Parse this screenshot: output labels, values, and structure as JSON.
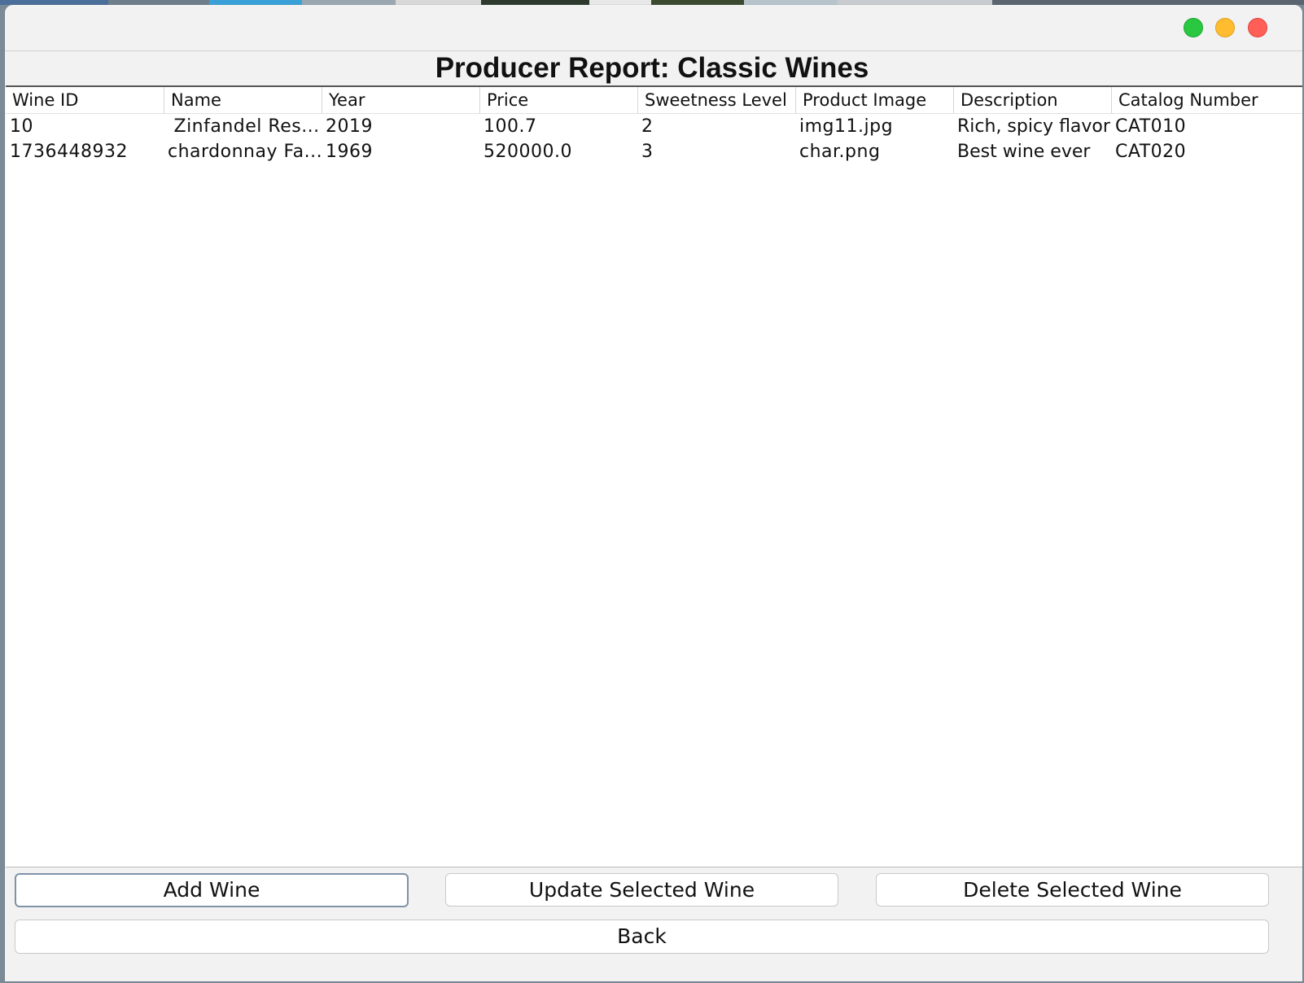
{
  "window": {
    "title": "Producer Report: Classic Wines"
  },
  "table": {
    "columns": [
      "Wine ID",
      "Name",
      "Year",
      "Price",
      "Sweetness Level",
      "Product Image",
      "Description",
      "Catalog Number"
    ],
    "rows": [
      [
        "10",
        " Zinfandel Res...",
        "2019",
        "100.7",
        "2",
        "img11.jpg",
        "Rich, spicy flavor",
        "CAT010"
      ],
      [
        "1736448932",
        "chardonnay Fa...",
        "1969",
        "520000.0",
        "3",
        "char.png",
        "Best wine ever",
        "CAT020"
      ]
    ]
  },
  "buttons": {
    "add": "Add Wine",
    "update": "Update Selected Wine",
    "delete": "Delete Selected Wine",
    "back": "Back"
  },
  "colors": {
    "traffic_green": "#29c840",
    "traffic_yellow": "#febc2e",
    "traffic_red": "#ff5f57",
    "focus_border": "#7f93a8"
  }
}
